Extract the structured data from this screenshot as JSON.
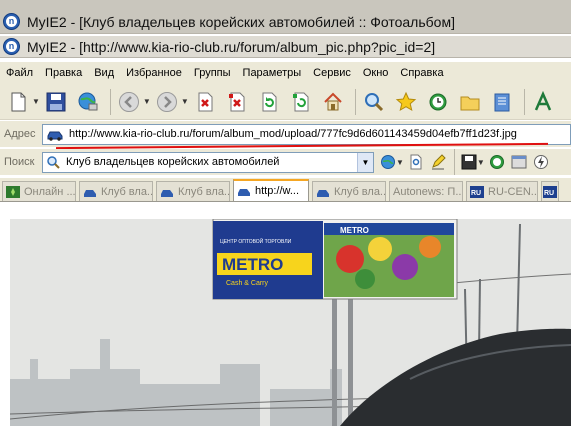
{
  "window": {
    "title_back": "MyIE2 - [Клуб владельцев корейских автомобилей :: Фотоальбом]",
    "title_front": "MyIE2 - [http://www.kia-rio-club.ru/forum/album_pic.php?pic_id=2]"
  },
  "menu": [
    "Файл",
    "Правка",
    "Вид",
    "Избранное",
    "Группы",
    "Параметры",
    "Сервис",
    "Окно",
    "Справка"
  ],
  "toolbar": {
    "buttons": [
      "new-page-icon",
      "save-icon",
      "globe-network-icon",
      "back-icon",
      "forward-icon",
      "stop-icon",
      "stop-all-icon",
      "refresh-icon",
      "refresh-all-icon",
      "home-icon",
      "search-icon",
      "favorites-star-icon",
      "history-icon",
      "folder-icon",
      "notepad-icon",
      "font-icon"
    ]
  },
  "address": {
    "label": "Адрес",
    "url": "http://www.kia-rio-club.ru/forum/album_mod/upload/777fc9d6d601143459d04efb7ff1d23f.jpg"
  },
  "search": {
    "label": "Поиск",
    "value": "Клуб владельцев корейских автомобилей"
  },
  "tabs": [
    {
      "label": "Онлайн ...",
      "active": false
    },
    {
      "label": "Клуб вла...",
      "active": false
    },
    {
      "label": "Клуб вла...",
      "active": false
    },
    {
      "label": "http://w...",
      "active": true
    },
    {
      "label": "Клуб вла...",
      "active": false
    },
    {
      "label": "Autonews: П...",
      "active": false
    },
    {
      "label": "RU-CEN...",
      "active": false
    },
    {
      "label": "RU",
      "active": false
    }
  ],
  "photo": {
    "billboard_brand": "METRO",
    "billboard_sub": "Cash & Carry",
    "billboard_top": "ЦЕНТР ОПТОВОЙ ТОРГОВЛИ"
  },
  "colors": {
    "titlebar": "#c9c6bd",
    "chrome": "#ece9d8",
    "url_underline": "#e01010",
    "active_tab_accent": "#f5a623",
    "metro_blue": "#1f3b8f",
    "metro_yellow": "#f7d41c"
  }
}
